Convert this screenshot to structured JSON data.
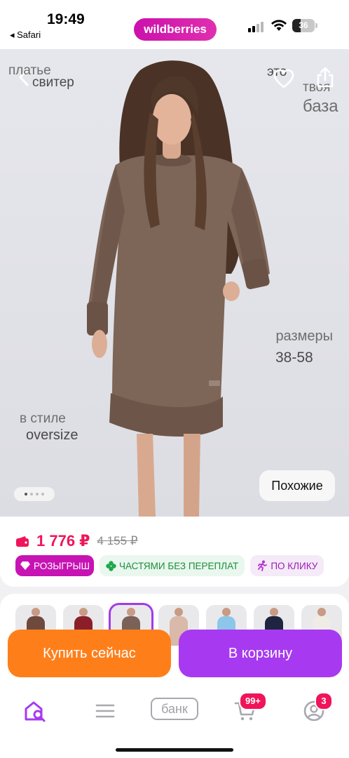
{
  "status_bar": {
    "time": "19:49",
    "back_app": "◂ Safari",
    "battery": "36",
    "battery_level": 0.36,
    "signal_bars": 2,
    "icons": [
      "signal-icon",
      "wifi-icon",
      "battery-icon"
    ]
  },
  "brand": {
    "logo_text": "wildberries",
    "color": "#cb11ab"
  },
  "photo": {
    "caption_top_left_1": "платье",
    "caption_top_left_2": "свитер",
    "caption_top_right_1": "это",
    "caption_top_right_2": "твоя",
    "caption_top_right_3": "база",
    "caption_sizes_1": "размеры",
    "caption_sizes_2": "38-58",
    "caption_style_1": "в стиле",
    "caption_style_2": "oversize",
    "similar_button": "Похожие",
    "slide_count": 4,
    "active_slide": 1,
    "icons": [
      "chevron-left-icon",
      "heart-icon",
      "share-icon"
    ]
  },
  "price": {
    "current": "1 776 ₽",
    "old": "4 155 ₽",
    "wallet_icon": "wallet-icon",
    "accent_color": "#f0145a"
  },
  "chips": [
    {
      "label": "РОЗЫГРЫШ",
      "icon": "diamond-icon"
    },
    {
      "label": "ЧАСТЯМИ БЕЗ ПЕРЕПЛАТ",
      "icon": "clover-icon"
    },
    {
      "label": "ПО КЛИКУ",
      "icon": "runner-icon"
    }
  ],
  "variants": {
    "colors": [
      "#6e4a3e",
      "#8a1f2a",
      "#7a6258",
      "#d9b9a9",
      "#8cc6e8",
      "#1d2540",
      "#efece6"
    ],
    "selected_index": 2
  },
  "actions": {
    "buy_now": "Купить сейчас",
    "add_to_cart": "В корзину",
    "buy_color": "#fe7f1a",
    "cart_color": "#a73af0"
  },
  "tabbar": {
    "bank": "банк",
    "cart_badge": "99+",
    "profile_badge": "3",
    "icons": [
      "home-search-icon",
      "menu-icon",
      "cart-icon",
      "profile-icon"
    ]
  }
}
